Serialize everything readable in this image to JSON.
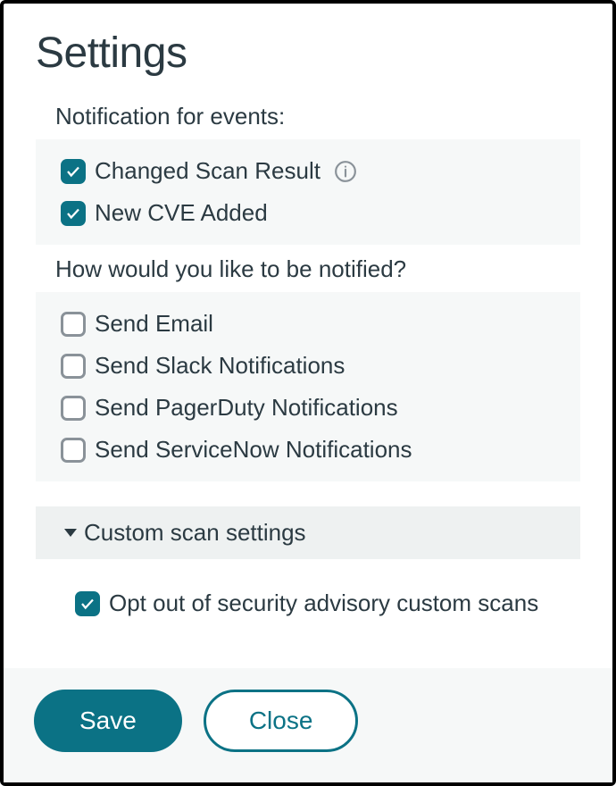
{
  "title": "Settings",
  "sections": {
    "events": {
      "label": "Notification for events:",
      "options": [
        {
          "label": "Changed Scan Result",
          "checked": true,
          "info": true
        },
        {
          "label": "New CVE Added",
          "checked": true,
          "info": false
        }
      ]
    },
    "channels": {
      "label": "How would you like to be notified?",
      "options": [
        {
          "label": "Send Email",
          "checked": false
        },
        {
          "label": "Send Slack Notifications",
          "checked": false
        },
        {
          "label": "Send PagerDuty Notifications",
          "checked": false
        },
        {
          "label": "Send ServiceNow Notifications",
          "checked": false
        }
      ]
    },
    "custom": {
      "title": "Custom scan settings",
      "options": [
        {
          "label": "Opt out of security advisory custom scans",
          "checked": true
        }
      ]
    }
  },
  "buttons": {
    "save": "Save",
    "close": "Close"
  }
}
